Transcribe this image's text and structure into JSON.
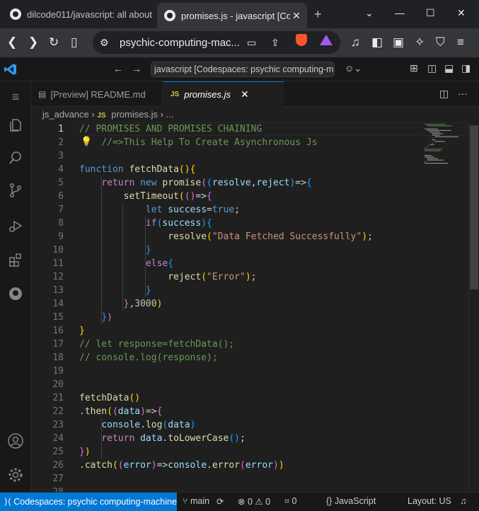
{
  "browser": {
    "tabs": [
      {
        "title": "dilcode011/javascript: all about",
        "active": false
      },
      {
        "title": "promises.js - javascript [Co",
        "active": true
      }
    ],
    "url": "psychic-computing-mac...",
    "new_tab": "+"
  },
  "vscode": {
    "command_center": "javascript [Codespaces: psychic computing-mach",
    "editor_tabs": [
      {
        "label": "[Preview] README.md",
        "active": false
      },
      {
        "label": "promises.js",
        "active": true,
        "badge": "JS"
      }
    ],
    "breadcrumb": {
      "folder": "js_advance",
      "file": "promises.js",
      "more": "..."
    },
    "current_line": 1,
    "code_lines": [
      "// PROMISES AND PROMISES CHAINING",
      "    //=>This Help To Create Asynchronous Js",
      "",
      "function fetchData(){",
      "    return new promise((resolve,reject)=>{",
      "        setTimeout(()=>{",
      "            let success=true;",
      "            if(success){",
      "                resolve(\"Data Fetched Successfully\");",
      "            }",
      "            else{",
      "                reject(\"Error\");",
      "            }",
      "        },3000)",
      "    })",
      "}",
      "// let response=fetchData();",
      "// console.log(response);",
      "",
      "",
      "fetchData()",
      ".then((data)=>{",
      "    console.log(data)",
      "    return data.toLowerCase();",
      "})",
      ".catch((error)=>console.error(error))",
      "",
      ""
    ]
  },
  "status": {
    "remote": "Codespaces: psychic computing-machine",
    "branch": "main",
    "errors": "0",
    "warnings": "0",
    "ports": "0",
    "language": "JavaScript",
    "layout": "Layout: US"
  },
  "colors": {
    "accent": "#0078d4",
    "background": "#1f1f1f"
  }
}
